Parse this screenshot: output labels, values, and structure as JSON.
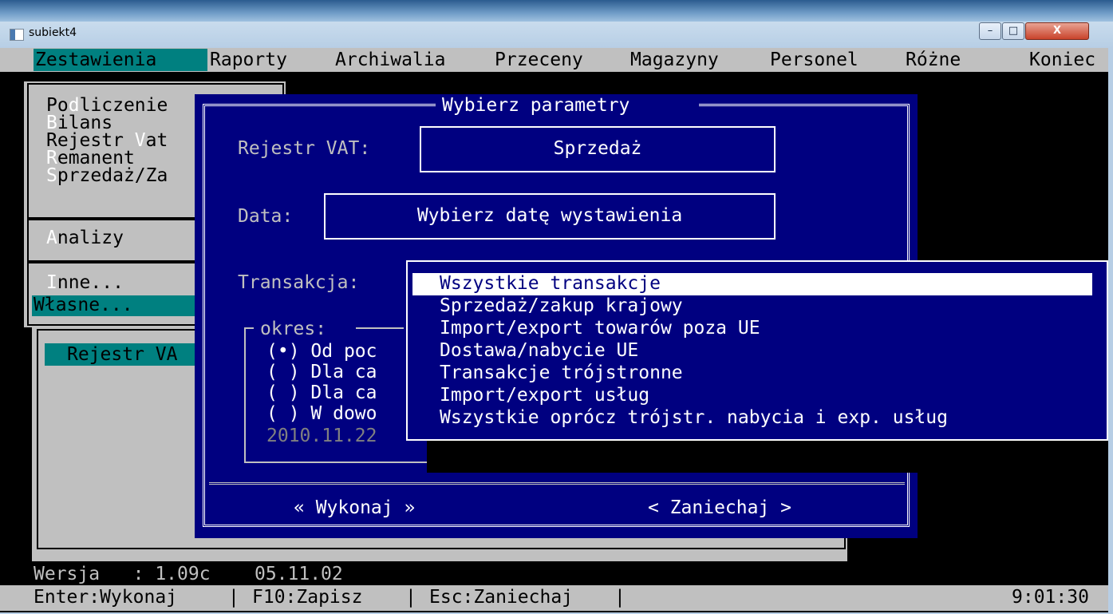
{
  "window": {
    "title": "subiekt4",
    "minimize": "–",
    "maximize": "□",
    "close": "X"
  },
  "menubar": [
    "Zestawienia",
    "Raporty",
    "Archiwalia",
    "Przeceny",
    "Magazyny",
    "Personel",
    "Różne",
    "Koniec"
  ],
  "left_menu": {
    "items": [
      {
        "hot": "",
        "rest": "Po",
        "hot2": "d",
        "rest2": "liczenie"
      },
      {
        "hot": "B",
        "rest": "ilans"
      },
      {
        "hot": "",
        "rest": "Rejestr ",
        "hot2": "V",
        "rest2": "at"
      },
      {
        "hot": "R",
        "rest": "emanent"
      },
      {
        "hot": "S",
        "rest": "przedaż/Za"
      },
      {
        "hot": "A",
        "rest": "nalizy"
      },
      {
        "hot": "I",
        "rest": "nne..."
      },
      {
        "hot": "",
        "rest": "Własne..."
      }
    ],
    "submenu_item": "Rejestr VA"
  },
  "dialog": {
    "title": "Wybierz parametry",
    "rejestr_label": "Rejestr VAT:",
    "rejestr_value": "Sprzedaż",
    "data_label": "Data:",
    "data_value": "Wybierz datę wystawienia",
    "transakcja_label": "Transakcja:",
    "okres_label": "okres:",
    "radios": [
      {
        "mark": "(•)",
        "text": "Od poc"
      },
      {
        "mark": "( )",
        "text": "Dla ca"
      },
      {
        "mark": "( )",
        "text": "Dla ca"
      },
      {
        "mark": "( )",
        "text": "W dowo"
      }
    ],
    "date_value": "2010.11.22",
    "execute_button": "« Wykonaj »",
    "cancel_button": "< Zaniechaj >"
  },
  "dropdown": {
    "selected_index": 0,
    "options": [
      "Wszystkie transakcje",
      "Sprzedaż/zakup krajowy",
      "Import/export towarów poza UE",
      "Dostawa/nabycie UE",
      "Transakcje trójstronne",
      "Import/export usług",
      "Wszystkie oprócz trójstr. nabycia i exp. usług"
    ]
  },
  "version_line": {
    "label": "Wersja",
    "value": ": 1.09c",
    "date": "05.11.02"
  },
  "statusbar": {
    "enter": "Enter:Wykonaj",
    "f10": "F10:Zapisz",
    "esc": "Esc:Zaniechaj",
    "clock": "9:01:30"
  },
  "colors": {
    "dos_blue": "#000080",
    "dos_teal": "#008080",
    "dos_gray": "#c0c0c0"
  }
}
